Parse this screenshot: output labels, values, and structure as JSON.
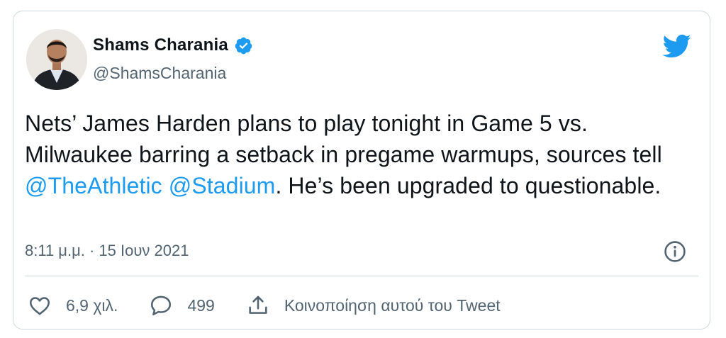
{
  "author": {
    "name": "Shams Charania",
    "handle": "@ShamsCharania",
    "verified": true
  },
  "tweet": {
    "text_before": "Nets’ James Harden plans to play tonight in Game 5 vs. Milwaukee barring a setback in pregame warmups, sources tell ",
    "mention_1": "@TheAthletic",
    "between_mentions": " ",
    "mention_2": "@Stadium",
    "text_after": ". He’s been upgraded to questionable."
  },
  "meta": {
    "timestamp": "8:11 μ.μ. · 15 Ιουν 2021"
  },
  "actions": {
    "likes_count": "6,9 χιλ.",
    "replies_count": "499",
    "share_label": "Κοινοποίηση αυτού του Tweet"
  },
  "colors": {
    "accent": "#1d9bf0",
    "text": "#0f1419",
    "secondary": "#536471",
    "border": "#cfd9de"
  },
  "icons": {
    "brand": "twitter-bird-icon",
    "verified": "verified-badge-icon",
    "info": "info-icon",
    "like": "heart-icon",
    "reply": "reply-bubble-icon",
    "share": "share-icon"
  }
}
